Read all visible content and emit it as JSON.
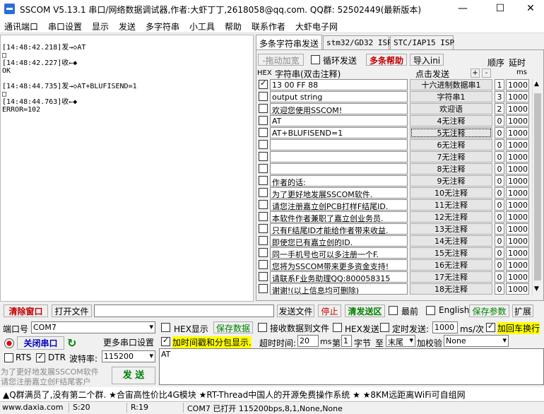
{
  "window": {
    "title": "SSCOM V5.13.1 串口/网络数据调试器,作者:大虾丁丁,2618058@qq.com. QQ群: 52502449(最新版本)",
    "minimize": "—",
    "maximize": "☐",
    "close": "✕"
  },
  "menu": [
    "通讯端口",
    "串口设置",
    "显示",
    "发送",
    "多字符串",
    "小工具",
    "帮助",
    "联系作者",
    "大虾电子网"
  ],
  "receive_log": "[14:48:42.218]发→◇AT\n□\n[14:48:42.227]收←◆\nOK\n\n[14:48:44.735]发→◇AT+BLUFISEND=1\n□\n[14:48:44.763]收←◆\nERROR=102",
  "tabs": [
    "多条字符串发送",
    "stm32/GD32 ISP",
    "STC/IAP15 ISP"
  ],
  "multi": {
    "drag_widen": "-拖动加宽",
    "loop_send": "循环发送",
    "help": "多条帮助",
    "import_ini": "导入ini",
    "order": "顺序",
    "delay": "延时",
    "hex": "HEX",
    "string_header": "字符串(双击注释)",
    "click_send": "点击发送",
    "plus": "+",
    "minus": "-",
    "ms": "ms"
  },
  "rows": [
    {
      "hex": true,
      "text": "13 00 FF 88",
      "button": "十六进制数据串1",
      "order": "1",
      "delay": "1000"
    },
    {
      "hex": false,
      "text": "output string",
      "button": "字符串1",
      "order": "3",
      "delay": "1000"
    },
    {
      "hex": false,
      "text": "欢迎您使用SSCOM!",
      "button": "欢迎语",
      "order": "2",
      "delay": "1000"
    },
    {
      "hex": false,
      "text": "AT",
      "button": "4无注释",
      "order": "0",
      "delay": "1000"
    },
    {
      "hex": false,
      "text": "AT+BLUFISEND=1",
      "button": "5无注释",
      "order": "0",
      "delay": "1000"
    },
    {
      "hex": false,
      "text": "",
      "button": "6无注释",
      "order": "0",
      "delay": "1000"
    },
    {
      "hex": false,
      "text": "",
      "button": "7无注释",
      "order": "0",
      "delay": "1000"
    },
    {
      "hex": false,
      "text": "",
      "button": "8无注释",
      "order": "0",
      "delay": "1000"
    },
    {
      "hex": false,
      "text": "作者的话:",
      "button": "9无注释",
      "order": "0",
      "delay": "1000"
    },
    {
      "hex": false,
      "text": "为了更好地发展SSCOM软件.",
      "button": "10无注释",
      "order": "0",
      "delay": "1000"
    },
    {
      "hex": false,
      "text": "请您注册嘉立创PCB打样F结尾ID.",
      "button": "11无注释",
      "order": "0",
      "delay": "1000"
    },
    {
      "hex": false,
      "text": "本软件作者兼职了嘉立创业务员.",
      "button": "12无注释",
      "order": "0",
      "delay": "1000"
    },
    {
      "hex": false,
      "text": "只有F结尾ID才能给作者带来收益.",
      "button": "13无注释",
      "order": "0",
      "delay": "1000"
    },
    {
      "hex": false,
      "text": "即使您已有嘉立创的ID.",
      "button": "14无注释",
      "order": "0",
      "delay": "1000"
    },
    {
      "hex": false,
      "text": "同一手机号也可以多注册一个F.",
      "button": "15无注释",
      "order": "0",
      "delay": "1000"
    },
    {
      "hex": false,
      "text": "您将为SSCOM带来更多资金支持!",
      "button": "16无注释",
      "order": "0",
      "delay": "1000"
    },
    {
      "hex": false,
      "text": "请联系F业务助理QQ:800058315",
      "button": "17无注释",
      "order": "0",
      "delay": "1000"
    },
    {
      "hex": false,
      "text": "谢谢!(以上信息均可删除)",
      "button": "18无注释",
      "order": "0",
      "delay": "1000"
    }
  ],
  "bar1": {
    "clear_window": "清除窗口",
    "open_file": "打开文件",
    "send_file": "发送文件",
    "stop": "停止",
    "clear_send": "清发送区",
    "topmost": "最前",
    "english": "English",
    "save_params": "保存参数",
    "expand": "扩展",
    "file_path": ""
  },
  "serial": {
    "port_label": "端口号",
    "port_value": "COM7",
    "hex_display": "HEX显示",
    "save_data": "保存数据",
    "recv_to_file": "接收数据到文件",
    "hex_send": "HEX发送",
    "timed_send": "定时发送:",
    "timed_value": "1000",
    "ms_per": "ms/次",
    "add_crlf": "加回车换行",
    "close_port": "关闭串口",
    "more_settings": "更多串口设置",
    "timestamp": "加时间戳和分包显示.",
    "timeout_label": "超时时间:",
    "timeout_value": "20",
    "ms": "ms",
    "nth": "第",
    "byte_no": "1",
    "byte_label": "字节",
    "to": "至",
    "end_value": "末尾",
    "checksum": "加校验",
    "checksum_value": "None",
    "rts": "RTS",
    "dtr": "DTR",
    "baud_label": "波特率:",
    "baud_value": "115200",
    "send_text": "AT",
    "send_button": "发 送",
    "promo1": "为了更好地发展SSCOM软件",
    "promo2": "请您注册嘉立创F结尾客户"
  },
  "ad": "▲Q群满员了,没有第二个群. ★合宙高性价比4G模块 ★RT-Thread中国人的开源免费操作系统 ★ ★8KM远距离WiFi可自组网",
  "status": {
    "url": "www.daxia.com",
    "s": "S:20",
    "r": "R:19",
    "port_info": "COM7 已打开  115200bps,8,1,None,None"
  },
  "colors": {
    "accent_red": "#c00000",
    "accent_green": "#008000",
    "highlight_yellow": "#ffff00"
  }
}
